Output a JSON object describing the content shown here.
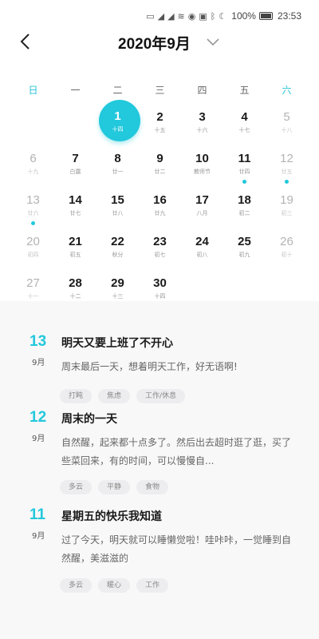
{
  "status_bar": {
    "battery": "100%",
    "time": "23:53"
  },
  "header": {
    "title": "2020年9月"
  },
  "weekdays": [
    "日",
    "一",
    "二",
    "三",
    "四",
    "五",
    "六"
  ],
  "calendar": {
    "days": [
      {
        "num": "1",
        "lunar": "十四",
        "selected": true
      },
      {
        "num": "2",
        "lunar": "十五"
      },
      {
        "num": "3",
        "lunar": "十六"
      },
      {
        "num": "4",
        "lunar": "十七"
      },
      {
        "num": "5",
        "lunar": "十八",
        "muted": true
      },
      {
        "num": "6",
        "lunar": "十九",
        "muted": true
      },
      {
        "num": "7",
        "lunar": "白露"
      },
      {
        "num": "8",
        "lunar": "廿一"
      },
      {
        "num": "9",
        "lunar": "廿二"
      },
      {
        "num": "10",
        "lunar": "教师节"
      },
      {
        "num": "11",
        "lunar": "廿四",
        "has_entry": true
      },
      {
        "num": "12",
        "lunar": "廿五",
        "muted": true,
        "has_entry": true
      },
      {
        "num": "13",
        "lunar": "廿六",
        "muted": true,
        "has_entry": true
      },
      {
        "num": "14",
        "lunar": "廿七"
      },
      {
        "num": "15",
        "lunar": "廿八"
      },
      {
        "num": "16",
        "lunar": "廿九"
      },
      {
        "num": "17",
        "lunar": "八月"
      },
      {
        "num": "18",
        "lunar": "初二"
      },
      {
        "num": "19",
        "lunar": "初三",
        "muted": true
      },
      {
        "num": "20",
        "lunar": "初四",
        "muted": true
      },
      {
        "num": "21",
        "lunar": "初五"
      },
      {
        "num": "22",
        "lunar": "秋分"
      },
      {
        "num": "23",
        "lunar": "初七"
      },
      {
        "num": "24",
        "lunar": "初八"
      },
      {
        "num": "25",
        "lunar": "初九"
      },
      {
        "num": "26",
        "lunar": "初十",
        "muted": true
      },
      {
        "num": "27",
        "lunar": "十一",
        "muted": true
      },
      {
        "num": "28",
        "lunar": "十二"
      },
      {
        "num": "29",
        "lunar": "十三"
      },
      {
        "num": "30",
        "lunar": "十四"
      }
    ]
  },
  "entries": [
    {
      "day": "13",
      "month": "9月",
      "title": "明天又要上班了不开心",
      "body": "周末最后一天，想着明天工作，好无语啊!",
      "tags": [
        "打盹",
        "焦虑",
        "工作/休息"
      ]
    },
    {
      "day": "12",
      "month": "9月",
      "title": "周末的一天",
      "body": "自然醒，起来都十点多了。然后出去超时逛了逛，买了些菜回来，有的时间，可以慢慢自...",
      "tags": [
        "多云",
        "平静",
        "食物"
      ]
    },
    {
      "day": "11",
      "month": "9月",
      "title": "星期五的快乐我知道",
      "body": "过了今天，明天就可以睡懒觉啦！哇咔咔，一觉睡到自然醒，美滋滋的",
      "tags": [
        "多云",
        "暖心",
        "工作"
      ]
    }
  ],
  "colors": {
    "accent": "#22c8dc",
    "panel_bg": "#f8f8f9",
    "tag_bg": "#ededef"
  }
}
